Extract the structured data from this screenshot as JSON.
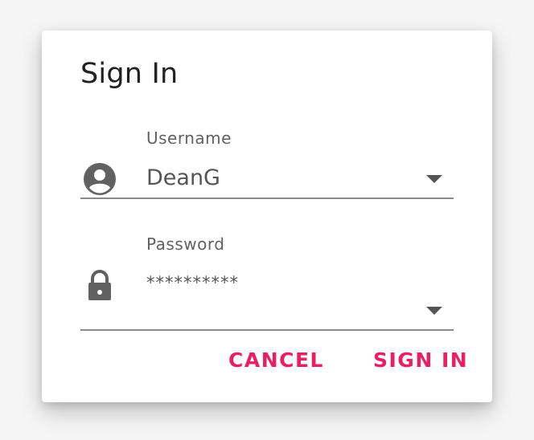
{
  "dialog": {
    "title": "Sign In",
    "accent_color": "#e91e63",
    "fields": {
      "username": {
        "label": "Username",
        "value": "DeanG",
        "icon": "account-circle-icon"
      },
      "password": {
        "label": "Password",
        "value": "**********",
        "icon": "lock-icon"
      }
    },
    "buttons": {
      "cancel_label": "CANCEL",
      "signin_label": "SIGN IN"
    }
  }
}
